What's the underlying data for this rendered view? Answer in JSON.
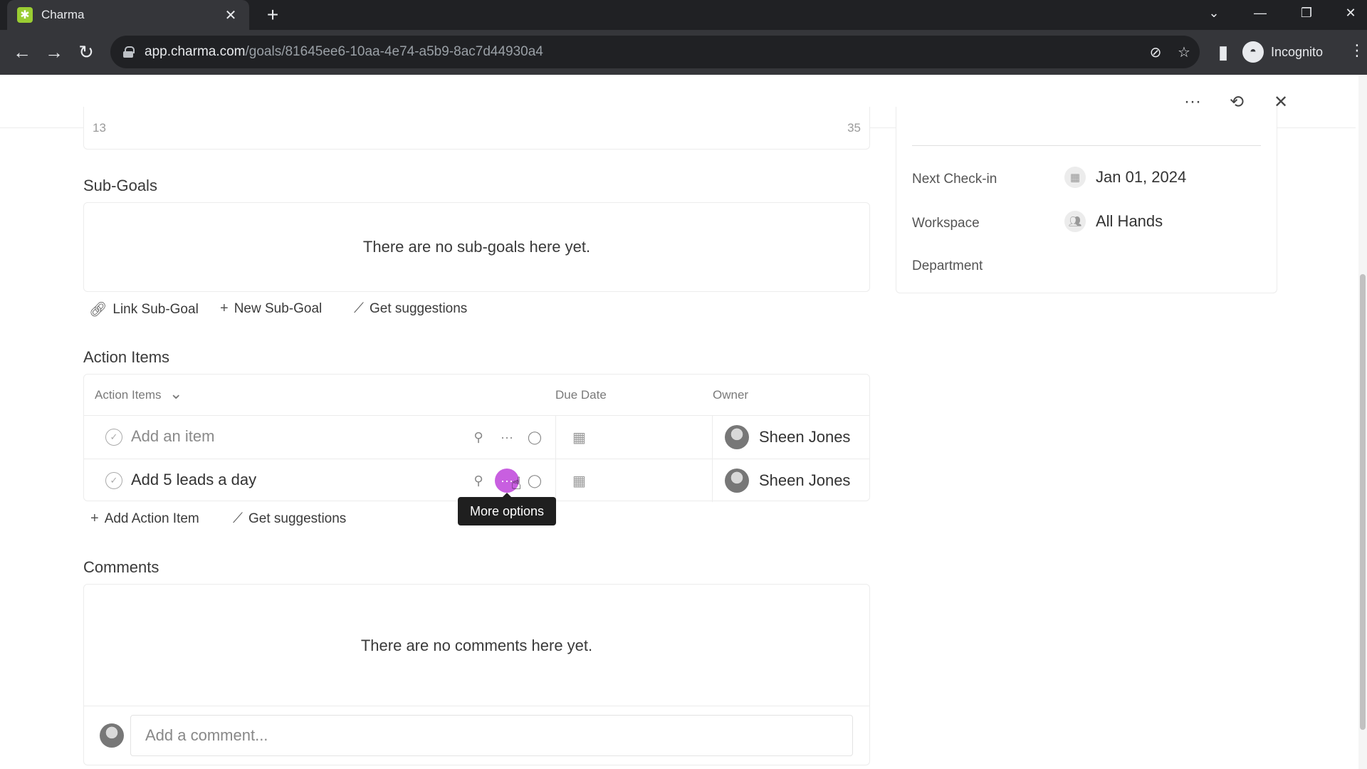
{
  "browser": {
    "tab_title": "Charma",
    "tab_close": "✕",
    "new_tab": "+",
    "url_host": "app.charma.com",
    "url_path": "/goals/81645ee6-10aa-4e74-a5b9-8ac7d44930a4",
    "incognito_label": "Incognito"
  },
  "progress": {
    "min": "13",
    "max": "35"
  },
  "sub_goals": {
    "title": "Sub-Goals",
    "empty_text": "There are no sub-goals here yet.",
    "link_label": "Link Sub-Goal",
    "new_label": "New Sub-Goal",
    "suggest_label": "Get suggestions"
  },
  "action_items": {
    "title": "Action Items",
    "col_items": "Action Items",
    "col_due": "Due Date",
    "col_owner": "Owner",
    "rows": [
      {
        "text": "Add an item",
        "owner": "Sheen Jones"
      },
      {
        "text": "Add 5 leads a day",
        "owner": "Sheen Jones"
      }
    ],
    "add_label": "Add Action Item",
    "suggest_label": "Get suggestions",
    "tooltip": "More options"
  },
  "comments": {
    "title": "Comments",
    "empty_text": "There are no comments here yet.",
    "input_placeholder": "Add a comment..."
  },
  "side_panel": {
    "next_checkin_label": "Next Check-in",
    "next_checkin_value": "Jan 01, 2024",
    "workspace_label": "Workspace",
    "workspace_value": "All Hands",
    "department_label": "Department"
  },
  "colors": {
    "accent": "#c85fe0",
    "favicon": "#9acd32",
    "chrome_dark": "#202124"
  },
  "icons": [
    "link-icon",
    "plus-icon",
    "magic-wand-icon",
    "pin-icon",
    "ellipsis-icon",
    "comment-icon",
    "calendar-icon",
    "history-icon",
    "close-icon",
    "people-icon",
    "check-icon",
    "chevron-down-icon"
  ]
}
